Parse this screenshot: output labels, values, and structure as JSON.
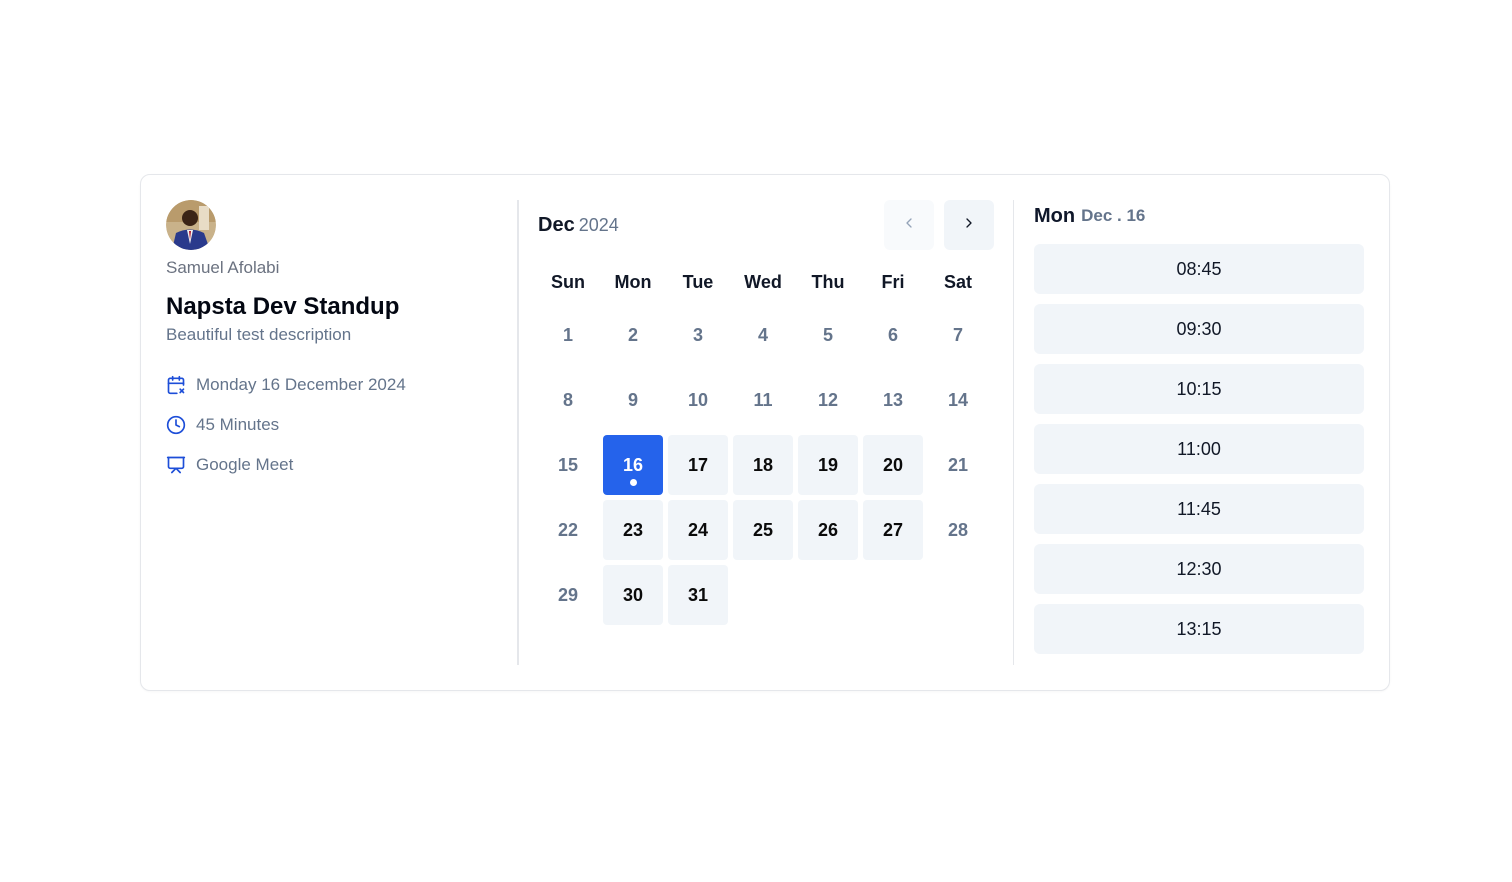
{
  "host": {
    "name": "Samuel Afolabi"
  },
  "event": {
    "title": "Napsta Dev Standup",
    "description": "Beautiful test description",
    "meta": [
      {
        "icon": "calendar-x-icon",
        "text": "Monday 16 December 2024"
      },
      {
        "icon": "clock-icon",
        "text": "45 Minutes"
      },
      {
        "icon": "presentation-icon",
        "text": "Google Meet"
      }
    ]
  },
  "calendar": {
    "month": "Dec",
    "year": "2024",
    "prev_icon": "chevron-left-icon",
    "next_icon": "chevron-right-icon",
    "weekdays": [
      "Sun",
      "Mon",
      "Tue",
      "Wed",
      "Thu",
      "Fri",
      "Sat"
    ],
    "days": [
      {
        "label": "1",
        "state": "unavailable"
      },
      {
        "label": "2",
        "state": "unavailable"
      },
      {
        "label": "3",
        "state": "unavailable"
      },
      {
        "label": "4",
        "state": "unavailable"
      },
      {
        "label": "5",
        "state": "unavailable"
      },
      {
        "label": "6",
        "state": "unavailable"
      },
      {
        "label": "7",
        "state": "unavailable"
      },
      {
        "label": "8",
        "state": "unavailable"
      },
      {
        "label": "9",
        "state": "unavailable"
      },
      {
        "label": "10",
        "state": "unavailable"
      },
      {
        "label": "11",
        "state": "unavailable"
      },
      {
        "label": "12",
        "state": "unavailable"
      },
      {
        "label": "13",
        "state": "unavailable"
      },
      {
        "label": "14",
        "state": "unavailable"
      },
      {
        "label": "15",
        "state": "unavailable"
      },
      {
        "label": "16",
        "state": "selected"
      },
      {
        "label": "17",
        "state": "available"
      },
      {
        "label": "18",
        "state": "available"
      },
      {
        "label": "19",
        "state": "available"
      },
      {
        "label": "20",
        "state": "available"
      },
      {
        "label": "21",
        "state": "unavailable"
      },
      {
        "label": "22",
        "state": "unavailable"
      },
      {
        "label": "23",
        "state": "available"
      },
      {
        "label": "24",
        "state": "available"
      },
      {
        "label": "25",
        "state": "available"
      },
      {
        "label": "26",
        "state": "available"
      },
      {
        "label": "27",
        "state": "available"
      },
      {
        "label": "28",
        "state": "unavailable"
      },
      {
        "label": "29",
        "state": "unavailable"
      },
      {
        "label": "30",
        "state": "available"
      },
      {
        "label": "31",
        "state": "available"
      }
    ]
  },
  "slots": {
    "day": "Mon",
    "date": "Dec . 16",
    "times": [
      "08:45",
      "09:30",
      "10:15",
      "11:00",
      "11:45",
      "12:30",
      "13:15"
    ]
  },
  "colors": {
    "accent": "#2563eb",
    "available_bg": "#f1f5f9",
    "muted_text": "#64748b",
    "icon_blue": "#1d4ed8"
  }
}
